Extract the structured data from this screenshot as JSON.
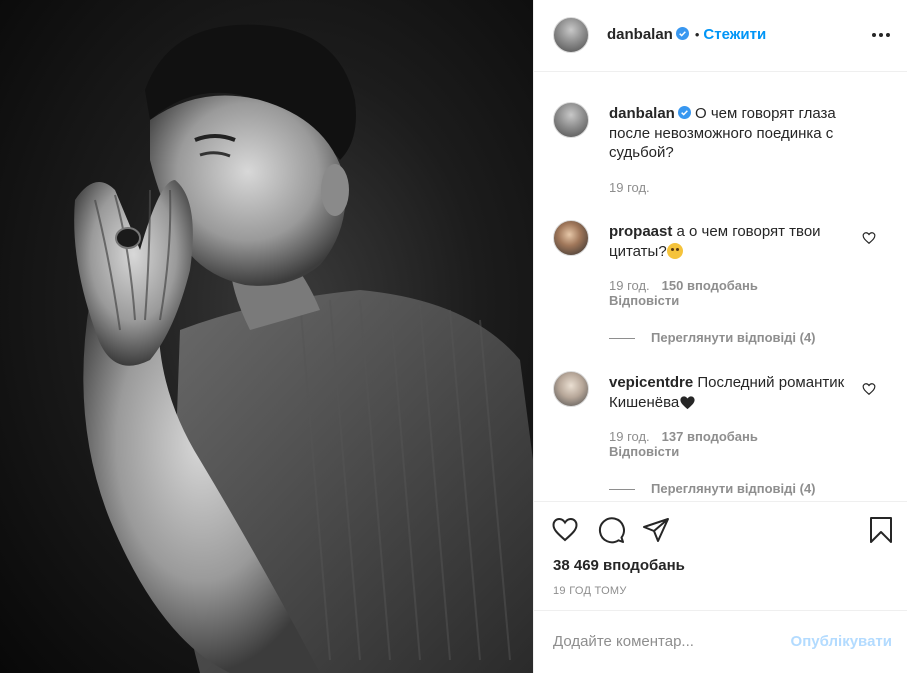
{
  "post": {
    "username": "danbalan",
    "follow_label": "Стежити",
    "dot": "•",
    "caption": "О чем говорят глаза после невозможного поединка с судьбой?",
    "caption_time": "19 год."
  },
  "comments": [
    {
      "username": "propaast",
      "text": "а о чем говорят твои цитаты?",
      "time": "19 год.",
      "likes": "150 вподобань",
      "reply_label": "Відповісти",
      "view_replies": "Переглянути відповіді (4)"
    },
    {
      "username": "vepicentdre",
      "text": "Последний романтик Кишенёва",
      "time": "19 год.",
      "likes": "137 вподобань",
      "reply_label": "Відповісти",
      "view_replies": "Переглянути відповіді (4)"
    }
  ],
  "footer": {
    "likes_count": "38 469 вподобань",
    "time_ago": "19 ГОД ТОМУ",
    "comment_placeholder": "Додайте коментар...",
    "post_label": "Опублікувати"
  },
  "colors": {
    "accent": "#0095f6",
    "muted": "#8e8e8e",
    "post_disabled": "#b3dbff"
  },
  "icons": [
    "verified-badge-icon",
    "more-options-icon",
    "heart-icon",
    "comment-icon",
    "share-icon",
    "bookmark-icon"
  ]
}
